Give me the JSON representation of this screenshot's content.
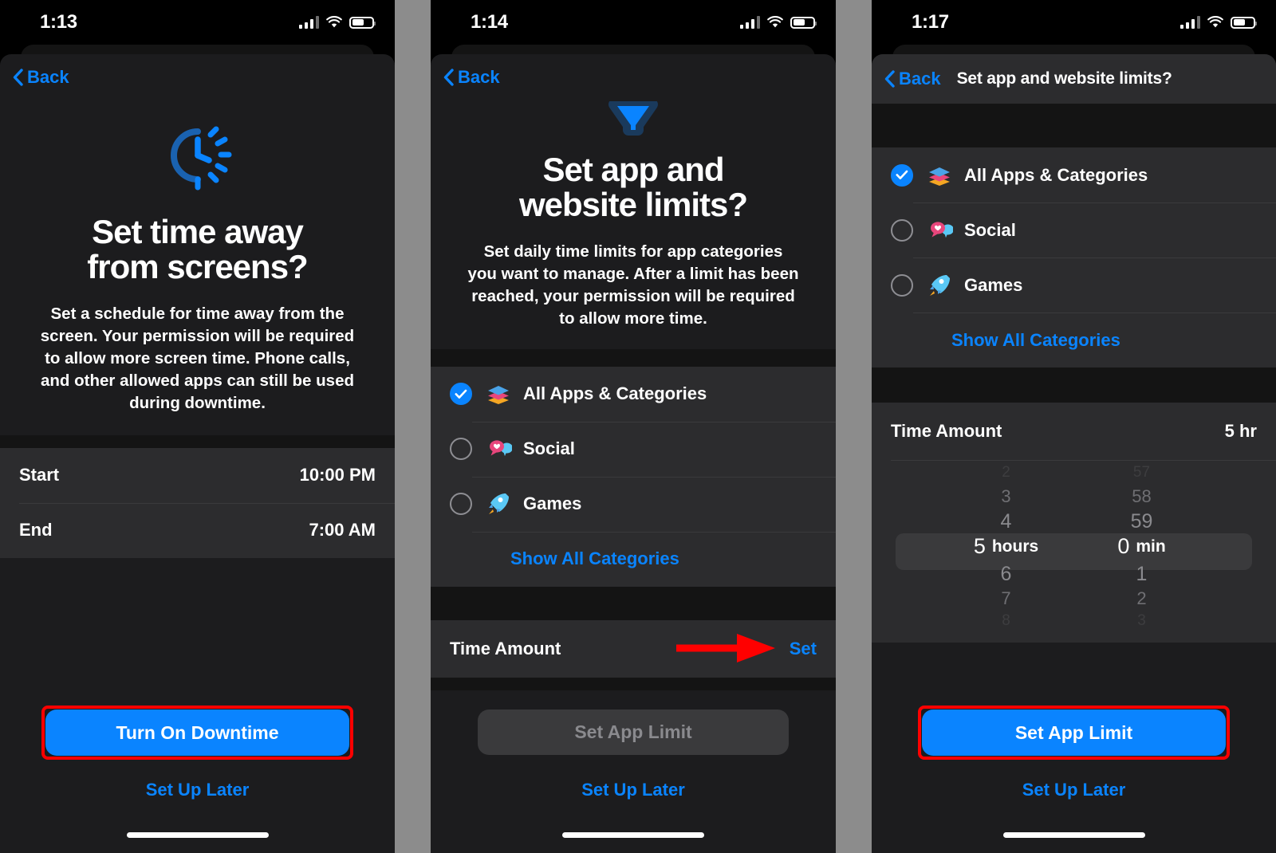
{
  "meta": {
    "accent_blue": "#0a84ff",
    "annotation_red": "#ff0000",
    "background_gray": "#8c8c8c",
    "card_bg": "#1c1c1e",
    "list_bg": "#2c2c2e"
  },
  "panels": [
    {
      "id": "downtime-screen",
      "status": {
        "time": "1:13",
        "signal_icon": "cellular-signal-icon",
        "wifi_icon": "wifi-icon",
        "battery_icon": "battery-icon",
        "battery_level": "60"
      },
      "nav": {
        "back_label": "Back",
        "title": ""
      },
      "hero": {
        "icon_name": "downtime-clock-icon",
        "title_line1": "Set time away",
        "title_line2": "from screens?",
        "description": "Set a schedule for time away from the screen. Your permission will be required to allow more screen time. Phone calls, and other allowed apps can still be used during downtime."
      },
      "schedule_rows": [
        {
          "label": "Start",
          "value": "10:00 PM"
        },
        {
          "label": "End",
          "value": "7:00 AM"
        }
      ],
      "footer": {
        "primary_label": "Turn On Downtime",
        "primary_state": "enabled",
        "primary_highlighted": true,
        "secondary_label": "Set Up Later"
      }
    },
    {
      "id": "app-limits-intro-screen",
      "status": {
        "time": "1:14",
        "signal_icon": "cellular-signal-icon",
        "wifi_icon": "wifi-icon",
        "battery_icon": "battery-icon",
        "battery_level": "60"
      },
      "nav": {
        "back_label": "Back",
        "title": ""
      },
      "hero": {
        "icon_name": "hourglass-icon",
        "title_line1": "Set app and",
        "title_line2": "website limits?",
        "description": "Set daily time limits for app categories you want to manage. After a limit has been reached, your permission will be required to allow more time."
      },
      "categories": [
        {
          "label": "All Apps & Categories",
          "icon_name": "stacked-layers-icon",
          "selected": true
        },
        {
          "label": "Social",
          "icon_name": "speech-bubble-heart-icon",
          "selected": false
        },
        {
          "label": "Games",
          "icon_name": "rocket-icon",
          "selected": false
        }
      ],
      "show_all_label": "Show All Categories",
      "time_amount": {
        "label": "Time Amount",
        "value": "Set",
        "value_is_link": true
      },
      "annotation": {
        "type": "arrow",
        "direction": "right",
        "color": "#ff0000",
        "points_to": "Set"
      },
      "footer": {
        "primary_label": "Set App Limit",
        "primary_state": "disabled",
        "primary_highlighted": false,
        "secondary_label": "Set Up Later"
      }
    },
    {
      "id": "app-limits-picker-screen",
      "status": {
        "time": "1:17",
        "signal_icon": "cellular-signal-icon",
        "wifi_icon": "wifi-icon",
        "battery_icon": "battery-icon",
        "battery_level": "60"
      },
      "nav": {
        "back_label": "Back",
        "title": "Set app and website limits?"
      },
      "categories": [
        {
          "label": "All Apps & Categories",
          "icon_name": "stacked-layers-icon",
          "selected": true
        },
        {
          "label": "Social",
          "icon_name": "speech-bubble-heart-icon",
          "selected": false
        },
        {
          "label": "Games",
          "icon_name": "rocket-icon",
          "selected": false
        }
      ],
      "show_all_label": "Show All Categories",
      "time_amount": {
        "label": "Time Amount",
        "value": "5 hr",
        "value_is_link": false
      },
      "picker": {
        "hours": {
          "unit_label": "hours",
          "selected": "5",
          "above": [
            "2",
            "3",
            "4"
          ],
          "below": [
            "6",
            "7",
            "8"
          ]
        },
        "minutes": {
          "unit_label": "min",
          "selected": "0",
          "above": [
            "57",
            "58",
            "59"
          ],
          "below": [
            "1",
            "2",
            "3"
          ]
        }
      },
      "footer": {
        "primary_label": "Set App Limit",
        "primary_state": "enabled",
        "primary_highlighted": true,
        "secondary_label": "Set Up Later"
      }
    }
  ]
}
